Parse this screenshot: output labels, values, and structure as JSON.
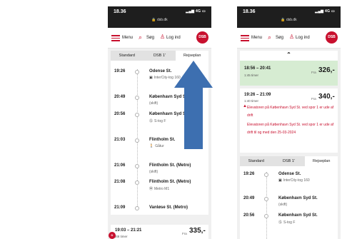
{
  "status": {
    "time": "18.36",
    "signal": "4G",
    "url": "dsb.dk"
  },
  "nav": {
    "menu_label": "Menu",
    "search_label": "Søg",
    "login_label": "Log ind",
    "logo_text": "DSB"
  },
  "tabs": [
    "Standard",
    "DSB 1'",
    "Rejseplan"
  ],
  "colors": {
    "brand_red": "#c8102e",
    "selected_green": "#d6ecd2",
    "arrow_blue": "#3d6fb0"
  },
  "phone1": {
    "stops": [
      {
        "time": "19:26",
        "station": "Odense St.",
        "detail": "InterCity-tog 160",
        "icon": "train-icon"
      },
      {
        "time": "20:49",
        "station": "København Syd St.",
        "detail": "(skift)",
        "icon": ""
      },
      {
        "time": "20:56",
        "station": "København Syd St.",
        "detail": "S-tog F",
        "icon": "s-train-icon"
      },
      {
        "time": "21:03",
        "station": "Flintholm St.",
        "detail": "Gåtur",
        "icon": "walk-icon"
      },
      {
        "time": "21:06",
        "station": "Flintholm St. (Metro)",
        "detail": "(skift)",
        "icon": ""
      },
      {
        "time": "21:08",
        "station": "Flintholm St. (Metro)",
        "detail": "Metro M1",
        "icon": "metro-icon"
      },
      {
        "time": "21:09",
        "station": "Vanløse St. (Metro)",
        "detail": "",
        "icon": ""
      }
    ],
    "trip": {
      "times": "19:03 – 21:21",
      "duration": "2t8 timer",
      "from_label": "Fra",
      "price": "335,-"
    }
  },
  "phone2": {
    "trip1": {
      "times": "18:56 – 20:41",
      "duration": "1:45 timer",
      "from_label": "Fra",
      "price": "326,-"
    },
    "trip2": {
      "times": "19:26 – 21:09",
      "duration": "1:40 timer",
      "from_label": "Fra",
      "price": "340,-",
      "warnings": [
        "Elevatoren på København Syd St. ved spor 1 er ude af drift",
        "Elevatoren på København Syd St. ved spor 1 er ude af drift til og med den 25-03-2024"
      ]
    },
    "stops": [
      {
        "time": "19:26",
        "station": "Odense St.",
        "detail": "InterCity-tog 160",
        "icon": "train-icon"
      },
      {
        "time": "20:49",
        "station": "København Syd St.",
        "detail": "(skift)",
        "icon": ""
      },
      {
        "time": "20:56",
        "station": "København Syd St.",
        "detail": "S-tog F",
        "icon": "s-train-icon"
      }
    ]
  }
}
